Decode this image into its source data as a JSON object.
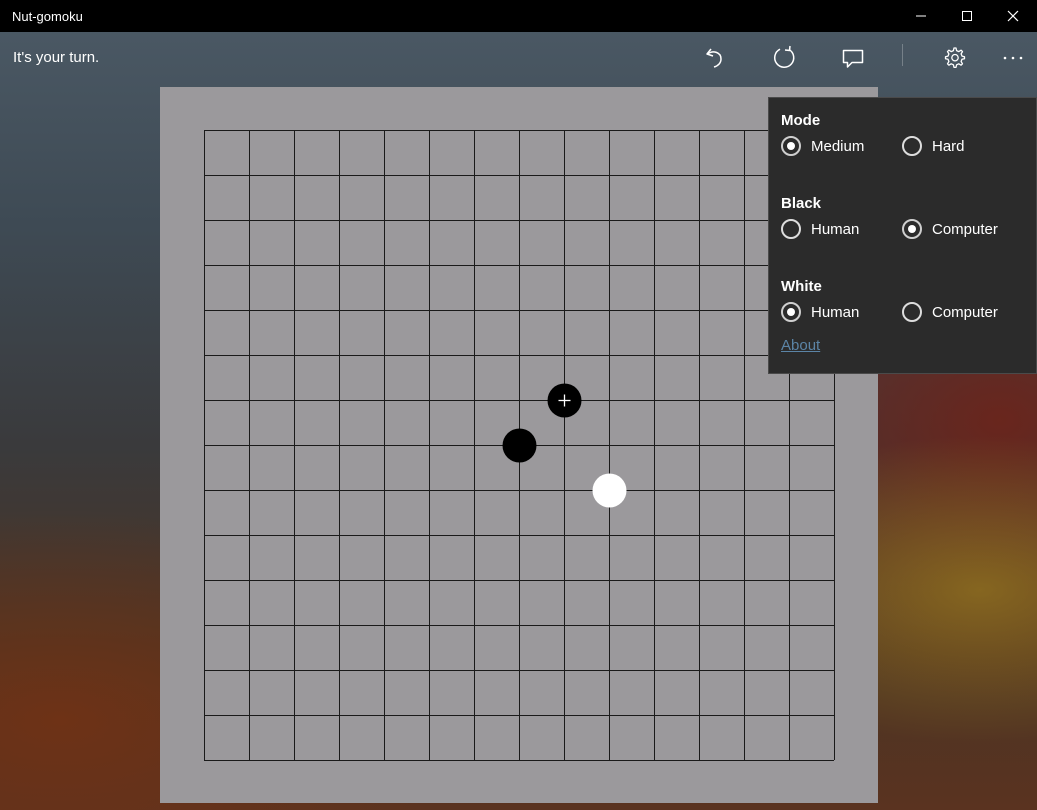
{
  "window": {
    "title": "Nut-gomoku"
  },
  "appbar": {
    "status": "It's your turn.",
    "buttons": [
      {
        "name": "undo-icon"
      },
      {
        "name": "restart-icon"
      },
      {
        "name": "chat-icon"
      },
      {
        "name": "settings-icon"
      },
      {
        "name": "more-icon"
      }
    ]
  },
  "board": {
    "size": 15,
    "stones": [
      {
        "col": 8,
        "row": 6,
        "color": "black",
        "last_move": true
      },
      {
        "col": 7,
        "row": 7,
        "color": "black",
        "last_move": false
      },
      {
        "col": 9,
        "row": 8,
        "color": "white",
        "last_move": false
      }
    ]
  },
  "settings": {
    "mode": {
      "label": "Mode",
      "options": [
        "Medium",
        "Hard"
      ],
      "selected": "Medium"
    },
    "black": {
      "label": "Black",
      "options": [
        "Human",
        "Computer"
      ],
      "selected": "Computer"
    },
    "white": {
      "label": "White",
      "options": [
        "Human",
        "Computer"
      ],
      "selected": "Human"
    },
    "about_link": "About"
  },
  "colors": {
    "board": "#9b999c",
    "grid_line": "#1a1a1a",
    "flyout_bg": "#2b2b2b",
    "link": "#5b84a6"
  }
}
